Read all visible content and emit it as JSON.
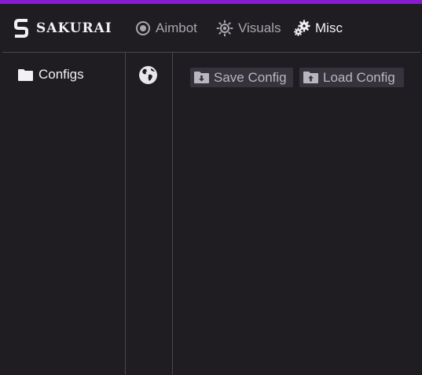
{
  "brand": {
    "name": "SAKURAI",
    "accent_color": "#8a1ad0"
  },
  "nav": {
    "aimbot": {
      "label": "Aimbot",
      "icon": "target-icon"
    },
    "visuals": {
      "label": "Visuals",
      "icon": "sun-icon"
    },
    "misc": {
      "label": "Misc",
      "icon": "gears-icon",
      "active": true
    }
  },
  "sidebar": {
    "items": [
      {
        "label": "Configs",
        "icon": "folder-icon"
      }
    ]
  },
  "subnav": {
    "icon": "globe-icon"
  },
  "actions": {
    "save": {
      "label": "Save Config",
      "icon": "download-folder-icon"
    },
    "load": {
      "label": "Load Config",
      "icon": "upload-folder-icon"
    }
  }
}
